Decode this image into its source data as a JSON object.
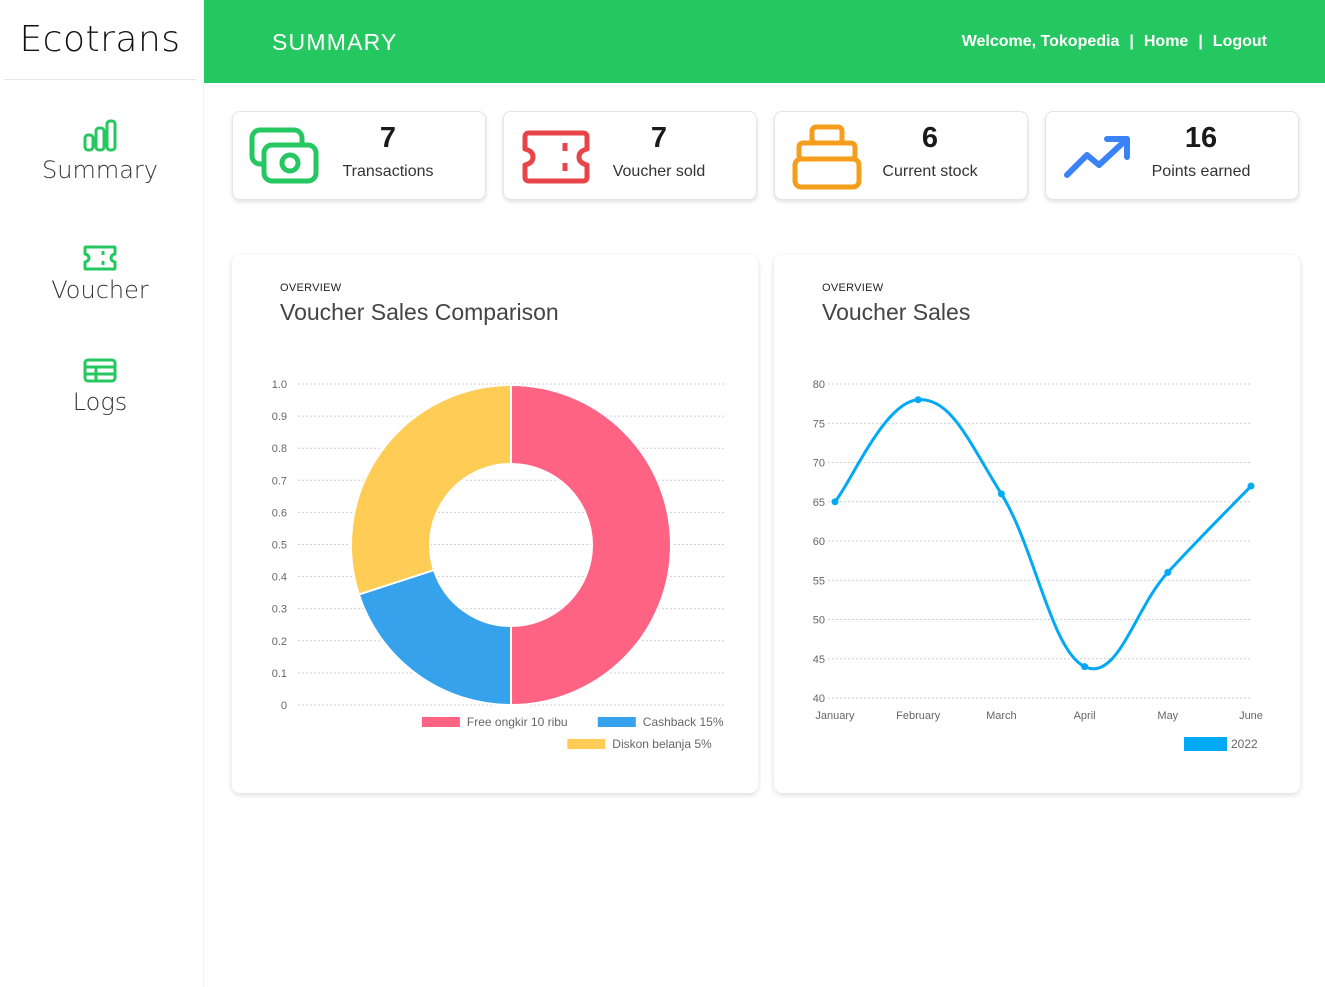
{
  "sidebar": {
    "brand": "Ecotrans",
    "items": [
      {
        "label": "Summary",
        "icon": "bar-chart-icon"
      },
      {
        "label": "Voucher",
        "icon": "ticket-icon"
      },
      {
        "label": "Logs",
        "icon": "table-icon"
      }
    ]
  },
  "topbar": {
    "title": "SUMMARY",
    "welcome": "Welcome, Tokopedia",
    "separator": "|",
    "home": "Home",
    "logout": "Logout",
    "color": "#25c760"
  },
  "stats": [
    {
      "value": "7",
      "label": "Transactions",
      "icon": "money-icon",
      "color": "#25c760"
    },
    {
      "value": "7",
      "label": "Voucher sold",
      "icon": "ticket-icon",
      "color": "#e8454a"
    },
    {
      "value": "6",
      "label": "Current stock",
      "icon": "box-icon",
      "color": "#f59e1b"
    },
    {
      "value": "16",
      "label": "Points earned",
      "icon": "trending-up-icon",
      "color": "#3b82f6"
    }
  ],
  "charts": {
    "left": {
      "overview": "OVERVIEW",
      "title": "Voucher Sales Comparison"
    },
    "right": {
      "overview": "OVERVIEW",
      "title": "Voucher Sales"
    }
  },
  "chart_data": [
    {
      "type": "pie",
      "title": "Voucher Sales Comparison",
      "doughnut": true,
      "categories": [
        "Free ongkir 10 ribu",
        "Cashback 15%",
        "Diskon belanja 5%"
      ],
      "values": [
        50,
        20,
        30
      ],
      "colors": [
        "#ff6384",
        "#36a2eb",
        "#ffcd56"
      ],
      "yticks": [
        "1.0",
        "0.9",
        "0.8",
        "0.7",
        "0.6",
        "0.5",
        "0.4",
        "0.3",
        "0.2",
        "0.1",
        "0"
      ],
      "ylim": [
        0,
        1
      ],
      "grid": true,
      "legend": "bottom-right"
    },
    {
      "type": "line",
      "title": "Voucher Sales",
      "x": [
        "January",
        "February",
        "March",
        "April",
        "May",
        "June"
      ],
      "series": [
        {
          "name": "2022",
          "values": [
            65,
            78,
            66,
            44,
            56,
            67
          ]
        }
      ],
      "yticks": [
        40,
        45,
        50,
        55,
        60,
        65,
        70,
        75,
        80
      ],
      "ylim": [
        40,
        80
      ],
      "color": "#03a9f4",
      "grid": true,
      "legend": "bottom-right"
    }
  ]
}
